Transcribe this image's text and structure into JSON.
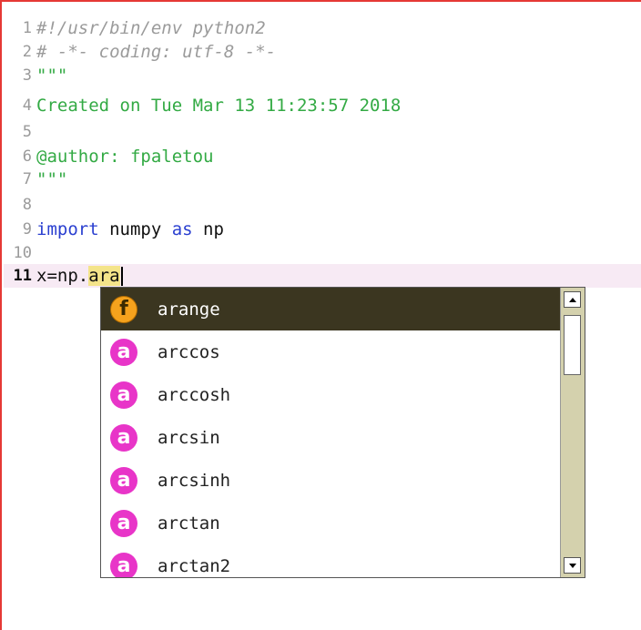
{
  "editor": {
    "lines": [
      {
        "num": "1",
        "text": "#!/usr/bin/env python2"
      },
      {
        "num": "2",
        "text": "# -*- coding: utf-8 -*-"
      },
      {
        "num": "3",
        "text": "\"\"\""
      },
      {
        "num": "4",
        "text": "Created on Tue Mar 13 11:23:57 2018"
      },
      {
        "num": "5",
        "text": ""
      },
      {
        "num": "6",
        "text": "@author: fpaletou"
      },
      {
        "num": "7",
        "text": "\"\"\""
      },
      {
        "num": "8",
        "text": ""
      },
      {
        "num": "9",
        "kw1": "import",
        "mid": " numpy ",
        "kw2": "as",
        "end": " np"
      },
      {
        "num": "10",
        "text": ""
      },
      {
        "num": "11",
        "prefix": "x=np.",
        "typed": "ara"
      }
    ]
  },
  "autocomplete": {
    "items": [
      {
        "label": "arange",
        "kind": "function",
        "badge": "f"
      },
      {
        "label": "arccos",
        "kind": "attribute",
        "badge": "a"
      },
      {
        "label": "arccosh",
        "kind": "attribute",
        "badge": "a"
      },
      {
        "label": "arcsin",
        "kind": "attribute",
        "badge": "a"
      },
      {
        "label": "arcsinh",
        "kind": "attribute",
        "badge": "a"
      },
      {
        "label": "arctan",
        "kind": "attribute",
        "badge": "a"
      },
      {
        "label": "arctan2",
        "kind": "attribute",
        "badge": "a"
      }
    ],
    "selected_index": 0
  },
  "colors": {
    "frame_border": "#e53935",
    "comment": "#9b9b9b",
    "docstring": "#33aa44",
    "keyword": "#2a3fd0",
    "current_line": "#f7eaf4",
    "selection": "#3b3620",
    "function_badge": "#f5a21d",
    "attribute_badge": "#e835c8",
    "scrollbar_track": "#d4d1ad"
  }
}
